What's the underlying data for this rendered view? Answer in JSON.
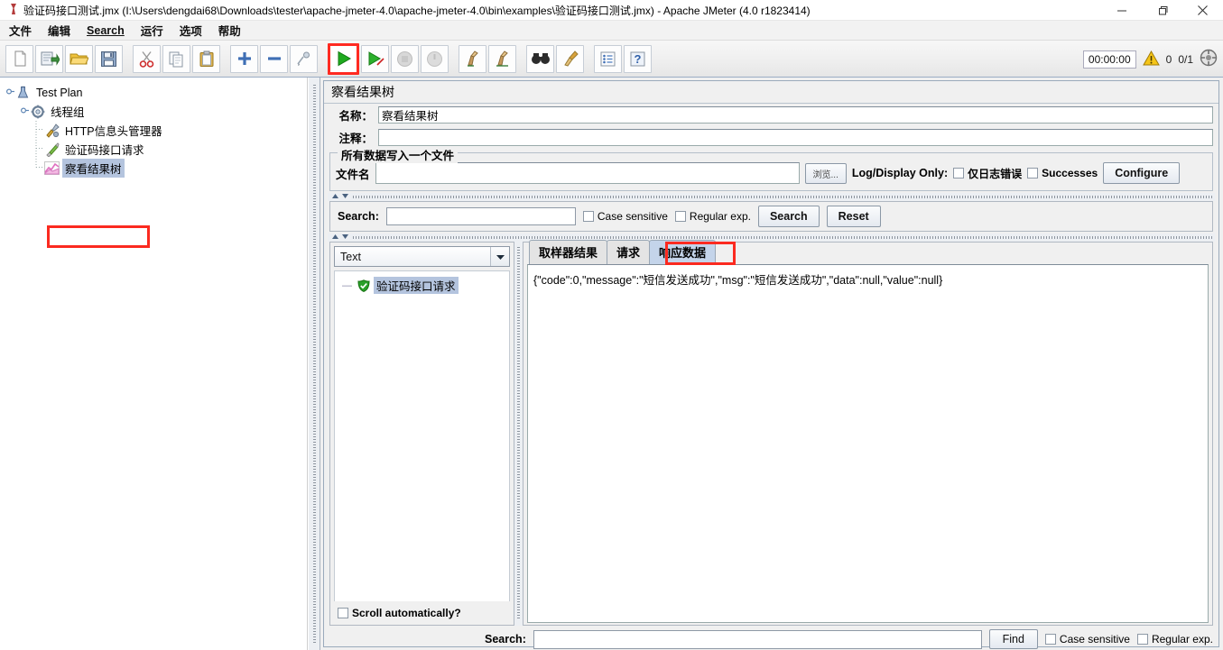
{
  "window": {
    "title": "验证码接口测试.jmx (I:\\Users\\dengdai68\\Downloads\\tester\\apache-jmeter-4.0\\apache-jmeter-4.0\\bin\\examples\\验证码接口测试.jmx) - Apache JMeter (4.0 r1823414)",
    "minimize": "minimize-icon",
    "maximize": "maximize-icon",
    "close": "close-icon"
  },
  "menu": {
    "items": [
      {
        "label": "文件",
        "underline": ""
      },
      {
        "label": "编辑",
        "underline": ""
      },
      {
        "label": "Search",
        "underline": "S"
      },
      {
        "label": "运行",
        "underline": ""
      },
      {
        "label": "选项",
        "underline": ""
      },
      {
        "label": "帮助",
        "underline": ""
      }
    ]
  },
  "toolbar": {
    "buttons": [
      {
        "name": "new-icon",
        "title": "新建"
      },
      {
        "name": "templates-icon",
        "title": "模板"
      },
      {
        "name": "open-icon",
        "title": "打开"
      },
      {
        "name": "save-icon",
        "title": "保存"
      },
      {
        "name": "cut-icon",
        "title": "剪切"
      },
      {
        "name": "copy-icon",
        "title": "复制"
      },
      {
        "name": "paste-icon",
        "title": "粘贴"
      },
      {
        "name": "expand-all-icon",
        "title": "展开"
      },
      {
        "name": "collapse-all-icon",
        "title": "收起"
      },
      {
        "name": "toggle-icon",
        "title": "切换"
      },
      {
        "name": "start-icon",
        "title": "启动"
      },
      {
        "name": "start-no-timers-icon",
        "title": "无间隔启动"
      },
      {
        "name": "stop-icon",
        "title": "停止"
      },
      {
        "name": "shutdown-icon",
        "title": "关闭"
      },
      {
        "name": "clear-icon",
        "title": "清除"
      },
      {
        "name": "clear-all-icon",
        "title": "清除全部"
      },
      {
        "name": "search-icon",
        "title": "查找"
      },
      {
        "name": "reset-search-icon",
        "title": "重置查找"
      },
      {
        "name": "function-helper-icon",
        "title": "函数助手"
      },
      {
        "name": "help-icon",
        "title": "帮助"
      }
    ],
    "timer": "00:00:00",
    "warn_count": "0",
    "thread_count": "0/1",
    "warning_icon": "warning-triangle-icon",
    "status_icon": "connection-status-icon"
  },
  "tree": {
    "nodes": [
      {
        "label": "Test Plan",
        "icon": "test-plan-icon",
        "indent": 0,
        "selected": false
      },
      {
        "label": "线程组",
        "icon": "thread-group-icon",
        "indent": 1,
        "selected": false
      },
      {
        "label": "HTTP信息头管理器",
        "icon": "header-manager-icon",
        "indent": 2,
        "selected": false
      },
      {
        "label": "验证码接口请求",
        "icon": "http-request-icon",
        "indent": 2,
        "selected": false
      },
      {
        "label": "察看结果树",
        "icon": "view-results-tree-icon",
        "indent": 2,
        "selected": true
      }
    ]
  },
  "panel": {
    "title": "察看结果树",
    "name_label": "名称：",
    "name_value": "察看结果树",
    "comment_label": "注释：",
    "comment_value": "",
    "file_group_legend": "所有数据写入一个文件",
    "filename_label": "文件名",
    "filename_value": "",
    "browse_button": "浏览...",
    "log_display_label": "Log/Display Only:",
    "errors_only_checkbox": "仅日志错误",
    "successes_checkbox": "Successes",
    "configure_button": "Configure"
  },
  "search_panel": {
    "label": "Search:",
    "value": "",
    "case_sensitive": "Case sensitive",
    "regular_exp": "Regular exp.",
    "search_button": "Search",
    "reset_button": "Reset"
  },
  "results": {
    "renderer_selected": "Text",
    "items": [
      {
        "label": "验证码接口请求",
        "icon": "success-shield-icon",
        "selected": true
      }
    ],
    "scroll_auto_label": "Scroll automatically?",
    "tabs": [
      {
        "label": "取样器结果",
        "active": false,
        "highlighted": false
      },
      {
        "label": "请求",
        "active": false,
        "highlighted": false
      },
      {
        "label": "响应数据",
        "active": true,
        "highlighted": true
      }
    ],
    "response_body": "{\"code\":0,\"message\":\"短信发送成功\",\"msg\":\"短信发送成功\",\"data\":null,\"value\":null}"
  },
  "bottom_search": {
    "label": "Search:",
    "value": "",
    "find_button": "Find",
    "case_sensitive": "Case sensitive",
    "regular_exp": "Regular exp."
  },
  "colors": {
    "highlight_red": "#fb2a20",
    "selection_blue": "#b4c4de",
    "active_tab_blue": "#c4d4ea",
    "start_green": "#22a522"
  }
}
